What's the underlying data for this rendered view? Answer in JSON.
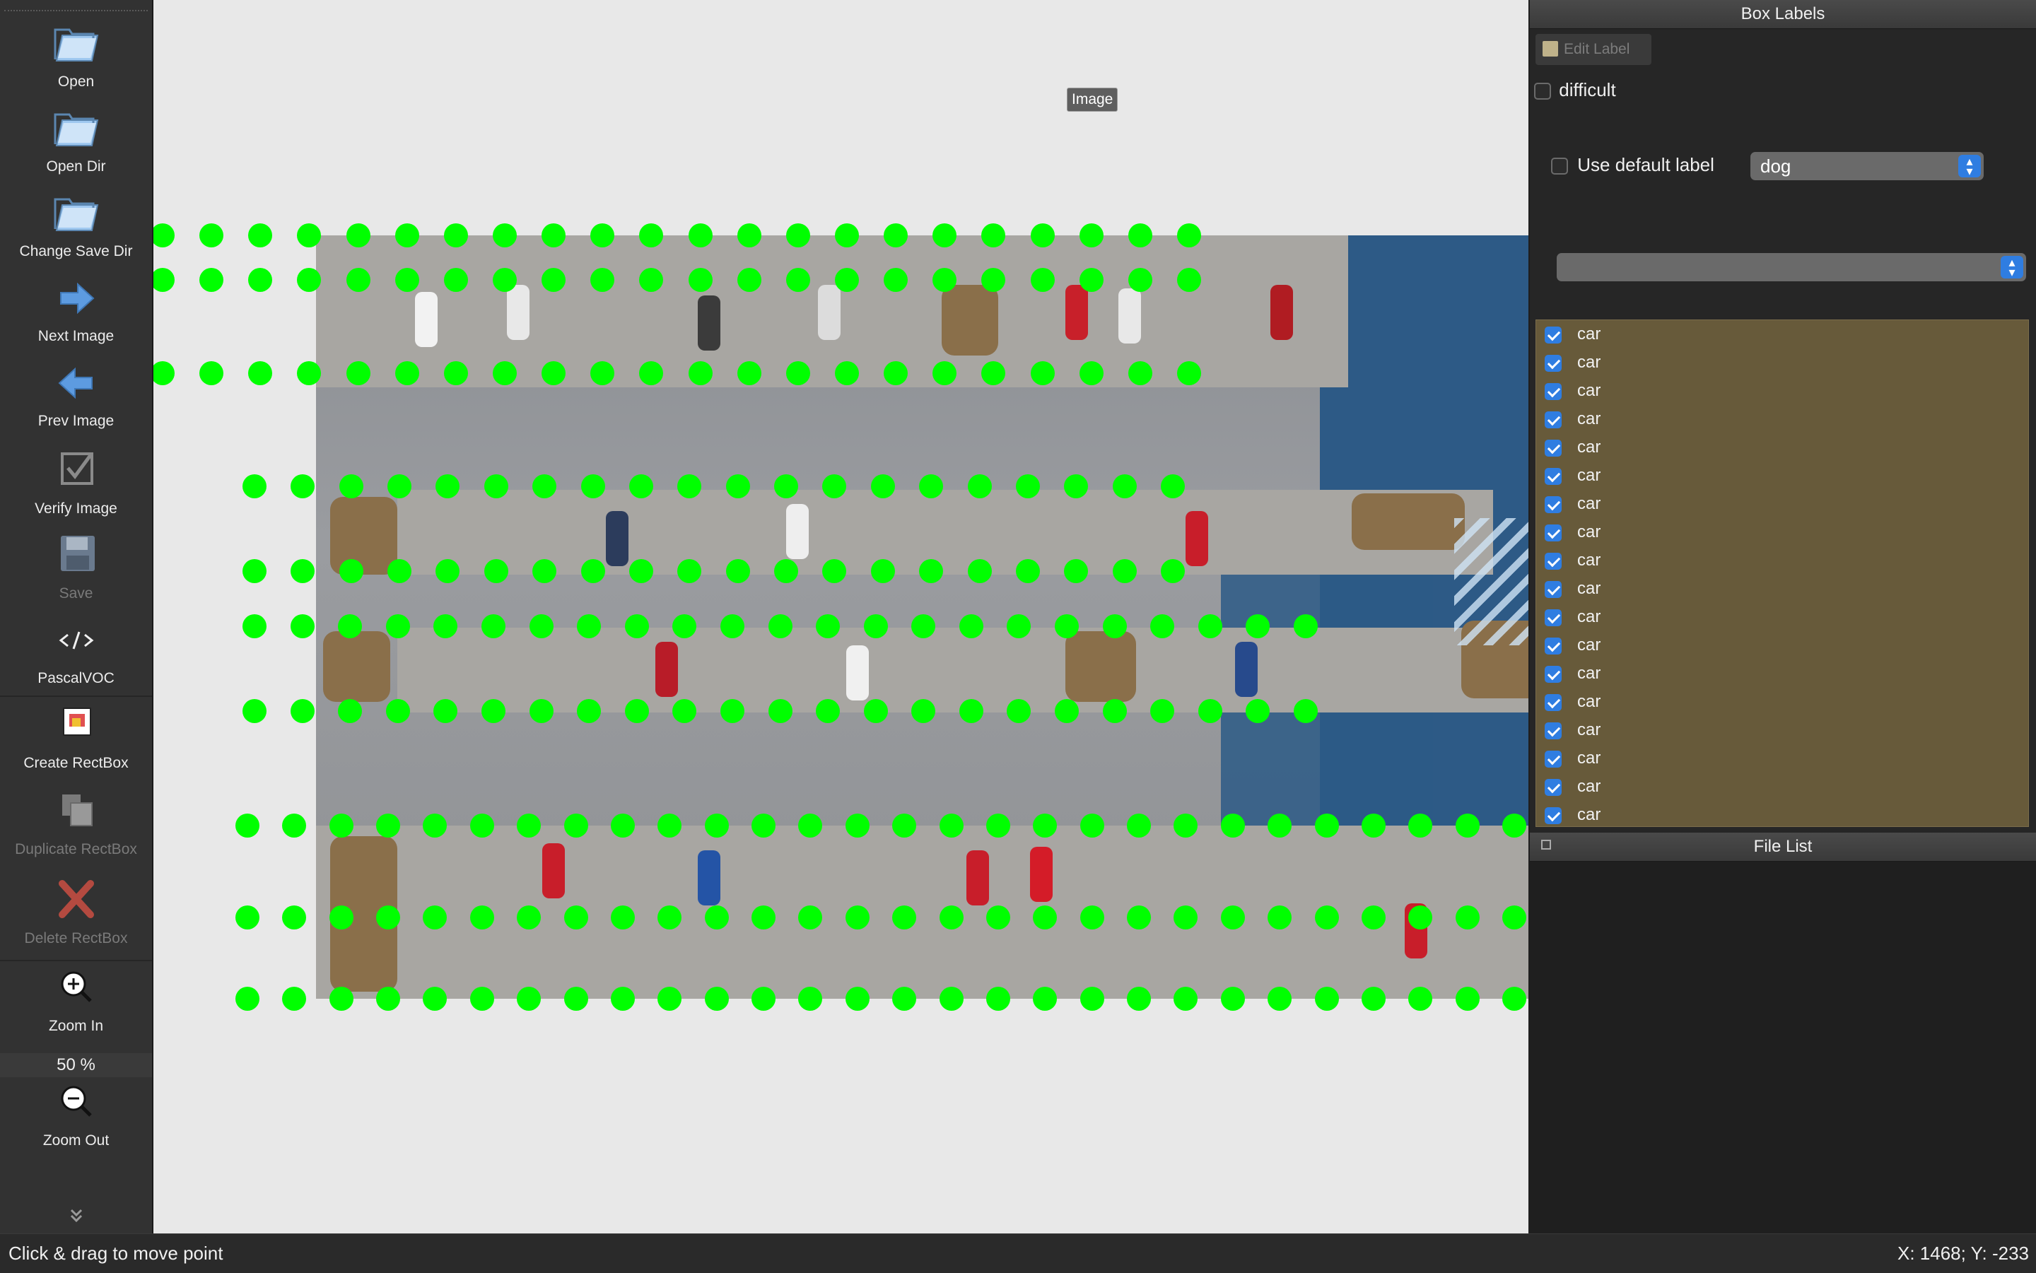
{
  "toolbar": {
    "items": [
      {
        "label": "Open",
        "icon": "folder-icon",
        "enabled": true
      },
      {
        "label": "Open Dir",
        "icon": "folder-icon",
        "enabled": true
      },
      {
        "label": "Change Save Dir",
        "icon": "folder-icon",
        "enabled": true
      },
      {
        "label": "Next Image",
        "icon": "arrow-right-icon",
        "enabled": true
      },
      {
        "label": "Prev Image",
        "icon": "arrow-left-icon",
        "enabled": true
      },
      {
        "label": "Verify Image",
        "icon": "verify-check-icon",
        "enabled": true
      },
      {
        "label": "Save",
        "icon": "floppy-disk-icon",
        "enabled": false
      },
      {
        "label": "PascalVOC",
        "icon": "code-icon",
        "enabled": true
      },
      {
        "label": "Create RectBox",
        "icon": "create-rect-icon",
        "enabled": true
      },
      {
        "label": "Duplicate RectBox",
        "icon": "duplicate-icon",
        "enabled": false
      },
      {
        "label": "Delete RectBox",
        "icon": "delete-x-icon",
        "enabled": false
      },
      {
        "label": "Zoom In",
        "icon": "zoom-in-icon",
        "enabled": true
      },
      {
        "label": "Zoom Out",
        "icon": "zoom-out-icon",
        "enabled": true
      }
    ],
    "zoom_value": "50 %"
  },
  "canvas": {
    "tooltip": "Image",
    "point_color": "#00ff00"
  },
  "box_labels": {
    "title": "Box Labels",
    "edit_label": "Edit Label",
    "difficult": "difficult",
    "difficult_checked": false,
    "use_default_label": "Use default label",
    "use_default_checked": false,
    "default_label_value": "dog",
    "second_dropdown_value": "",
    "labels": [
      "car",
      "car",
      "car",
      "car",
      "car",
      "car",
      "car",
      "car",
      "car",
      "car",
      "car",
      "car",
      "car",
      "car",
      "car",
      "car",
      "car",
      "car"
    ]
  },
  "file_list": {
    "title": "File List"
  },
  "status": {
    "message": "Click & drag to move point",
    "coords": "X: 1468; Y: -233"
  },
  "colors": {
    "accent": "#2f7de1",
    "label_list_bg": "#675a3a",
    "canvas_bg": "#e8e8e8"
  }
}
